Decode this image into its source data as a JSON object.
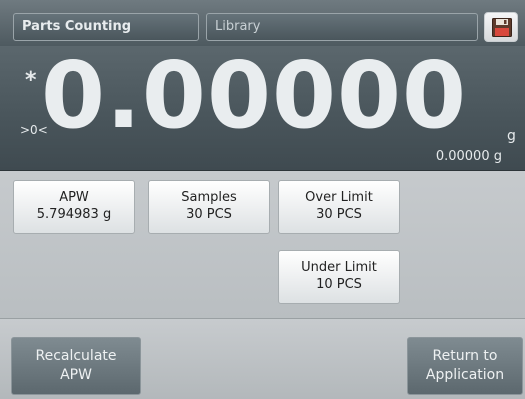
{
  "header": {
    "app_tab": "Parts Counting",
    "library_tab": "Library",
    "save_icon": "floppy-disk-icon"
  },
  "reading": {
    "stable_indicator": "*",
    "zero_indicator": ">0<",
    "main_value": "0.00000",
    "unit": "g",
    "secondary_value": "0.00000 g"
  },
  "params": {
    "apw": {
      "label": "APW",
      "value": "5.794983 g"
    },
    "samples": {
      "label": "Samples",
      "value": "30 PCS"
    },
    "over_limit": {
      "label": "Over Limit",
      "value": "30 PCS"
    },
    "under_limit": {
      "label": "Under Limit",
      "value": "10 PCS"
    }
  },
  "footer": {
    "recalculate": {
      "line1": "Recalculate",
      "line2": "APW"
    },
    "return": {
      "line1": "Return to",
      "line2": "Application"
    }
  }
}
